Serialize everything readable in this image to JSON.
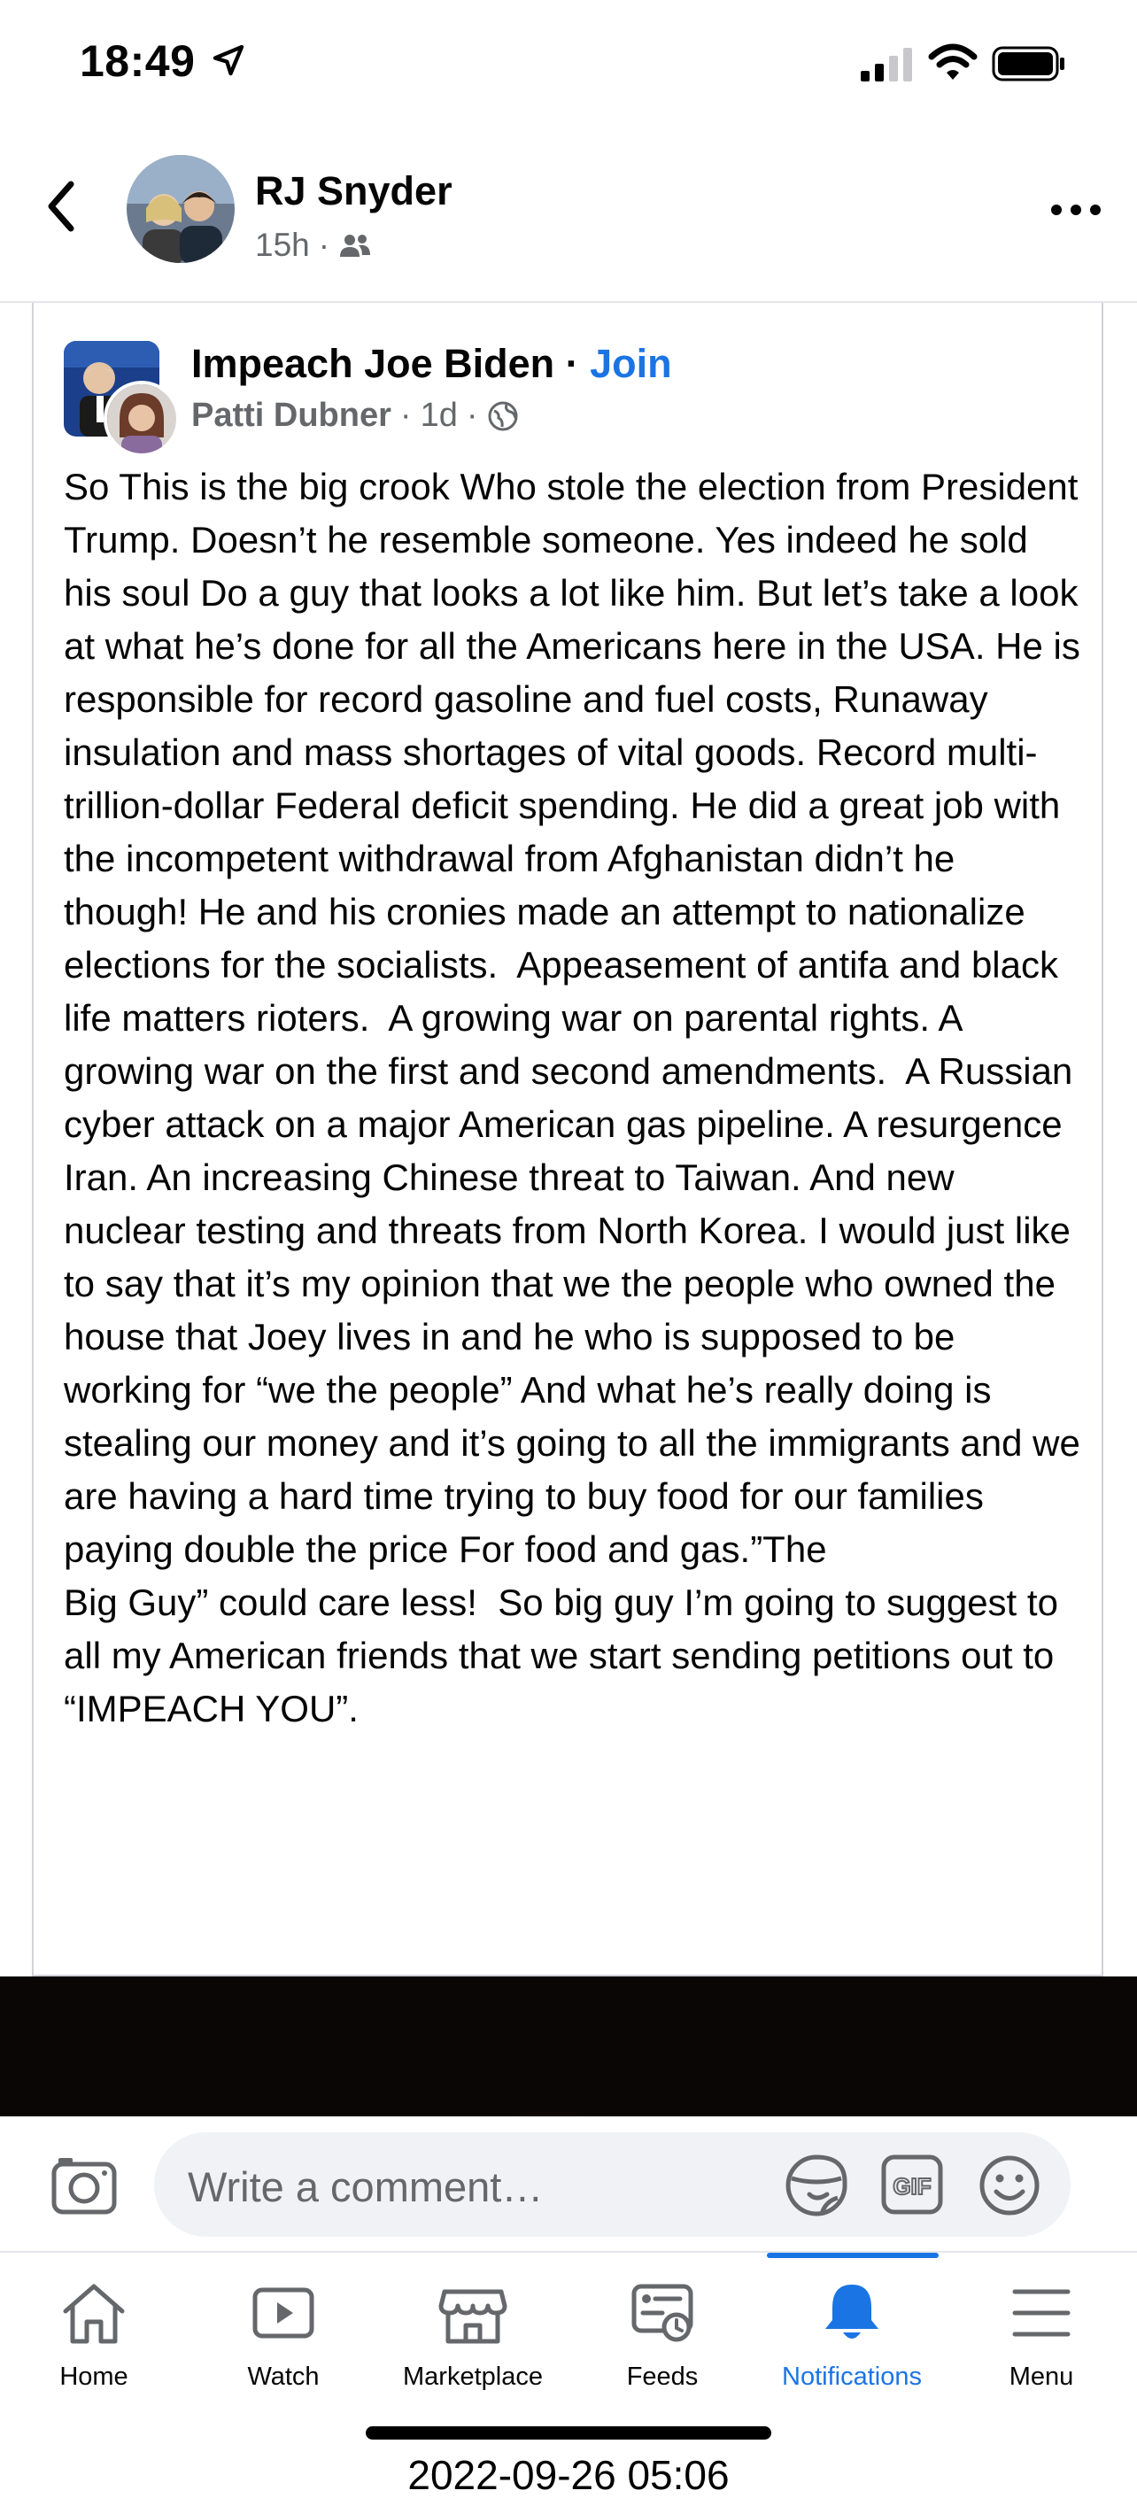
{
  "status_bar": {
    "time": "18:49"
  },
  "post": {
    "author": "RJ Snyder",
    "age": "15h",
    "shared": {
      "group": "Impeach Joe Biden",
      "separator": "·",
      "join_label": "Join",
      "sharer": "Patti Dubner",
      "age": "1d",
      "body": "So This is the big crook Who stole the election from President Trump. Doesn’t he resemble someone. Yes indeed he sold his soul Do a guy that looks a lot like him. But let’s take a look at what he’s done for all the Americans here in the USA. He is responsible for record gasoline and fuel costs, Runaway insulation and mass shortages of vital goods. Record multi- trillion-dollar Federal deficit spending. He did a great job with the incompetent withdrawal from Afghanistan didn’t he though! He and his cronies made an attempt to nationalize elections for the socialists.  Appeasement of antifa and black life matters rioters.  A growing war on parental rights. A growing war on the first and second amendments.  A Russian cyber attack on a major American gas pipeline. A resurgence Iran. An increasing Chinese threat to Taiwan. And new nuclear testing and threats from North Korea. I would just like to say that it’s my opinion that we the people who owned the house that Joey lives in and he who is supposed to be working for “we the people” And what he’s really doing is stealing our money and it’s going to all the immigrants and we are having a hard time trying to buy food for our families paying double the price For food and gas.”The\nBig Guy” could care less!  So big guy I’m going to suggest to all my American friends that we start sending petitions out to\n“IMPEACH YOU”."
    }
  },
  "comment": {
    "placeholder": "Write a comment…"
  },
  "tabs": [
    {
      "label": "Home",
      "icon": "home-icon"
    },
    {
      "label": "Watch",
      "icon": "watch-icon"
    },
    {
      "label": "Marketplace",
      "icon": "marketplace-icon"
    },
    {
      "label": "Feeds",
      "icon": "feeds-icon"
    },
    {
      "label": "Notifications",
      "icon": "bell-icon",
      "active": true
    },
    {
      "label": "Menu",
      "icon": "menu-icon"
    }
  ],
  "timestamp": "2022-09-26 05:06",
  "colors": {
    "accent": "#1b74e4",
    "secondary_text": "#65676b"
  }
}
